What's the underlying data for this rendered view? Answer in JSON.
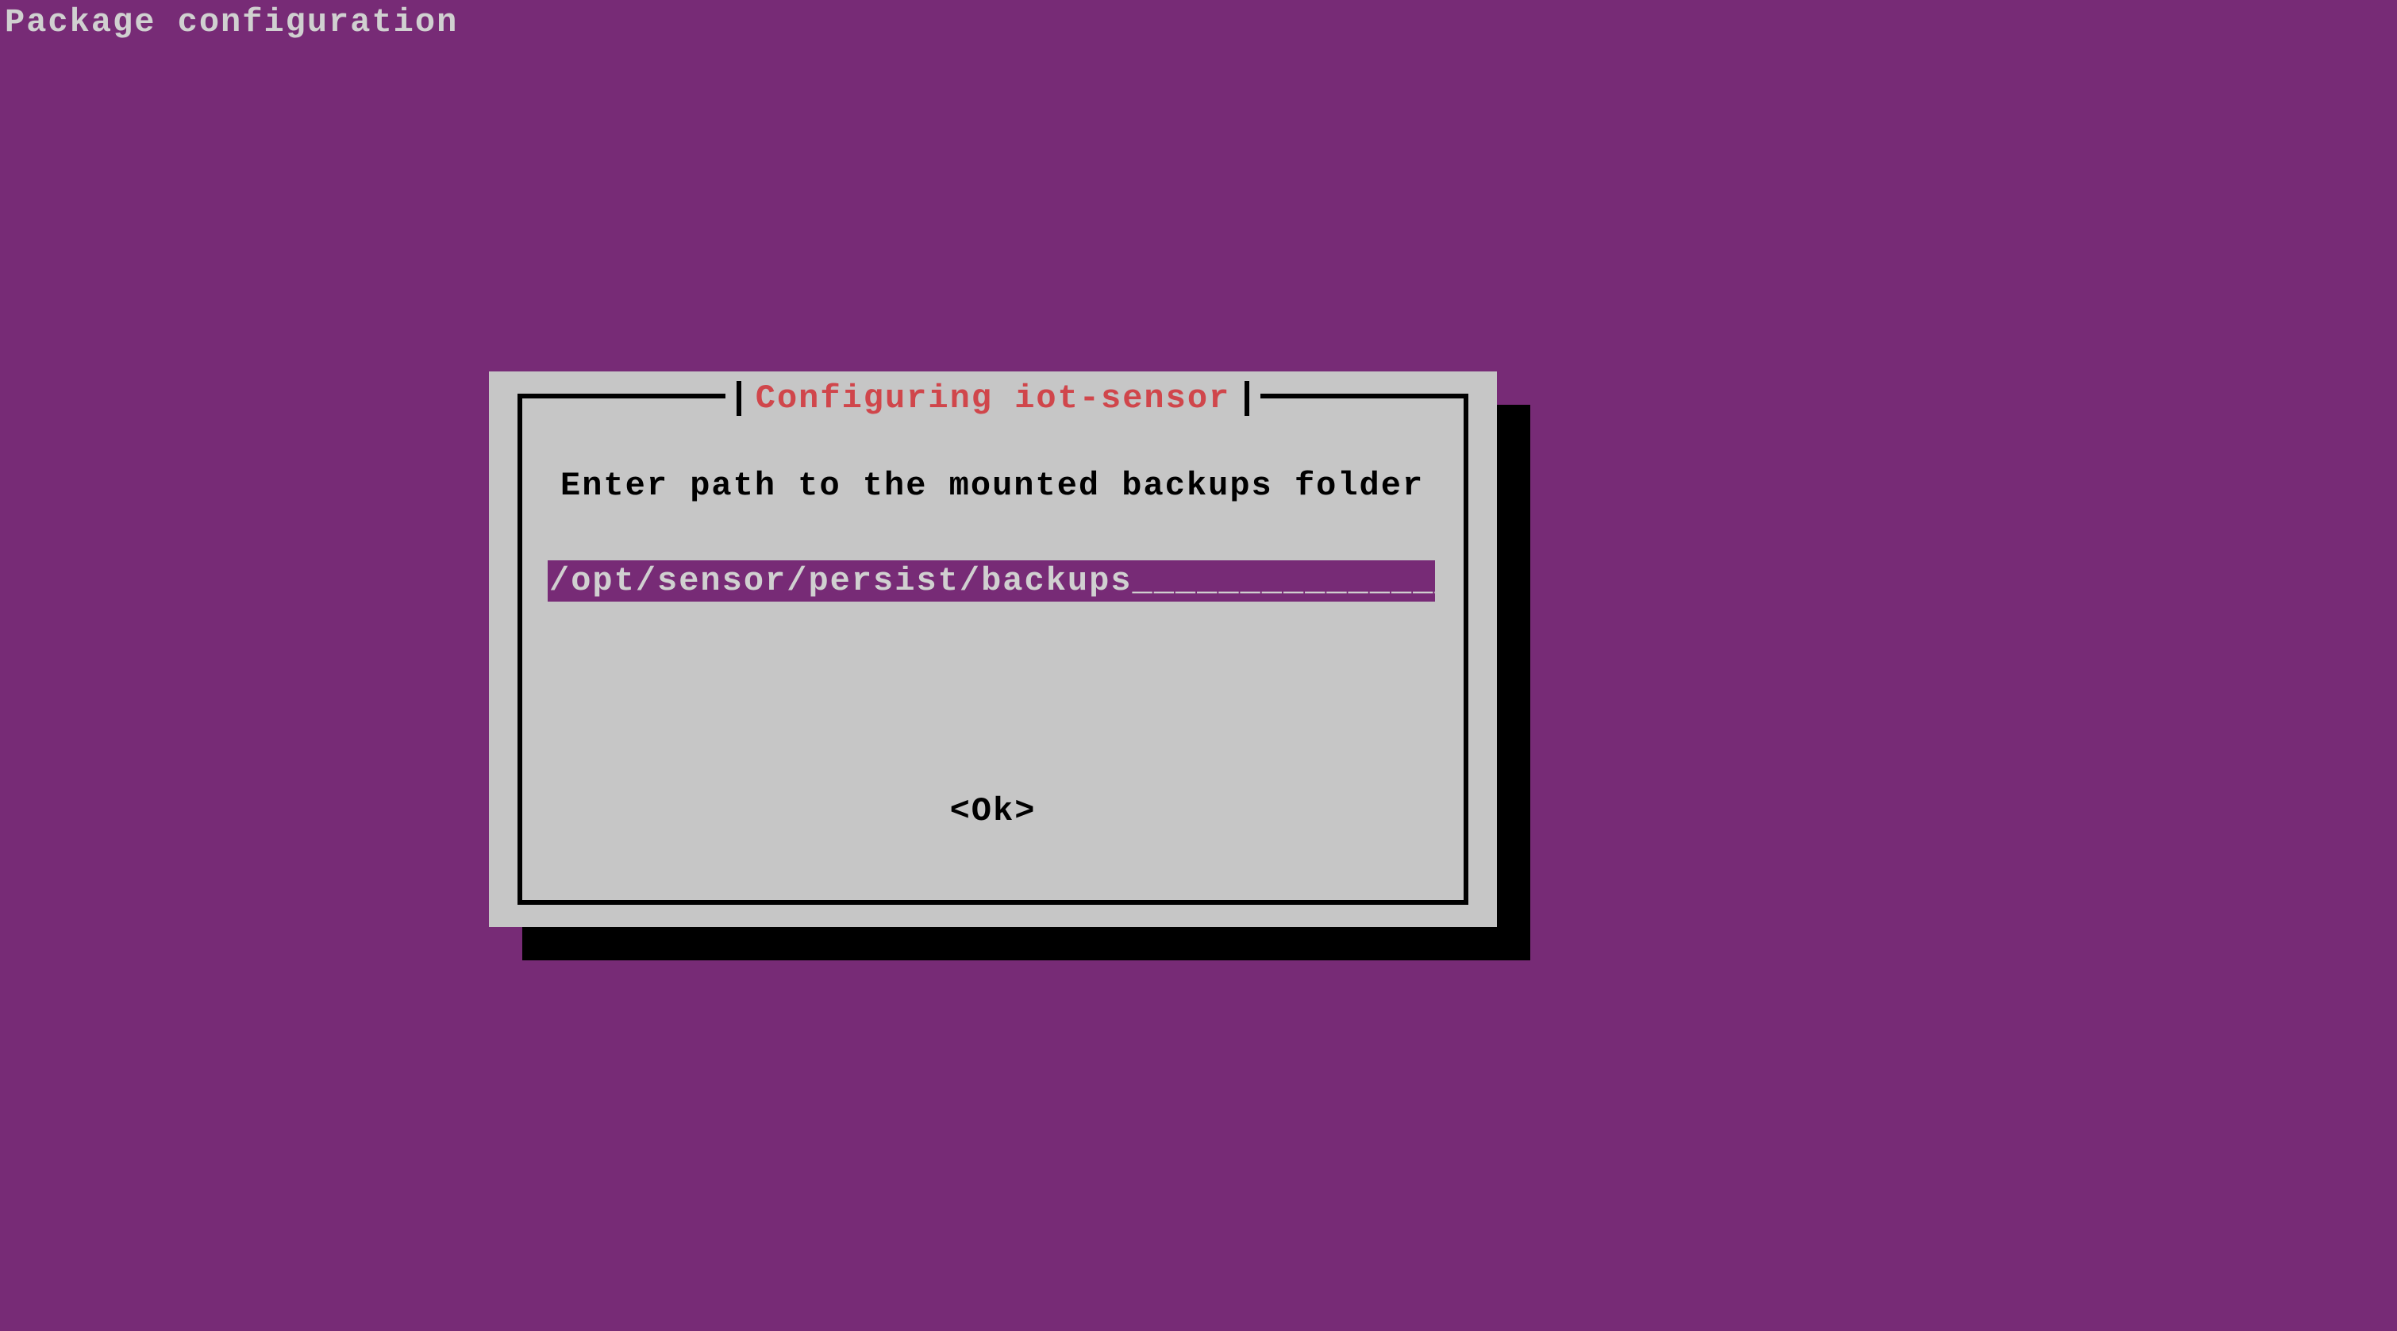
{
  "header": {
    "title": "Package configuration"
  },
  "dialog": {
    "title": "Configuring iot-sensor",
    "prompt": "Enter path to the mounted backups folder",
    "input_value": "/opt/sensor/persist/backups",
    "input_field_width_chars": 42,
    "ok_label": "<Ok>"
  }
}
